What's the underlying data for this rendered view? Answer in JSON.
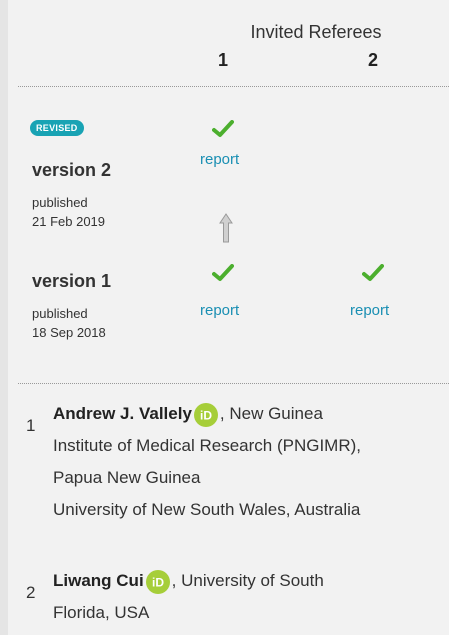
{
  "header": {
    "invited_referees": "Invited Referees",
    "referee_1": "1",
    "referee_2": "2"
  },
  "badge": "REVISED",
  "versions": [
    {
      "title": "version 2",
      "published_label": "published",
      "date": "21 Feb 2019",
      "reports": [
        {
          "status": "approved",
          "label": "report"
        }
      ]
    },
    {
      "title": "version 1",
      "published_label": "published",
      "date": "18 Sep 2018",
      "reports": [
        {
          "status": "approved",
          "label": "report"
        },
        {
          "status": "approved",
          "label": "report"
        }
      ]
    }
  ],
  "referees": [
    {
      "index": "1",
      "name": "Andrew J. Vallely",
      "affil_line1": ", New Guinea",
      "affil_line2": "Institute of Medical Research (PNGIMR),",
      "affil_line3": "Papua New Guinea",
      "affil_line4": "University of New South Wales, Australia"
    },
    {
      "index": "2",
      "name": "Liwang Cui",
      "affil_line1": ", University of South",
      "affil_line2": "Florida, USA"
    }
  ],
  "colors": {
    "check": "#4caf2e",
    "link": "#1a8fb3",
    "badge": "#19a3b4",
    "orcid": "#a6ce39"
  },
  "icons": [
    "check-icon",
    "up-arrow-icon",
    "orcid-icon"
  ]
}
